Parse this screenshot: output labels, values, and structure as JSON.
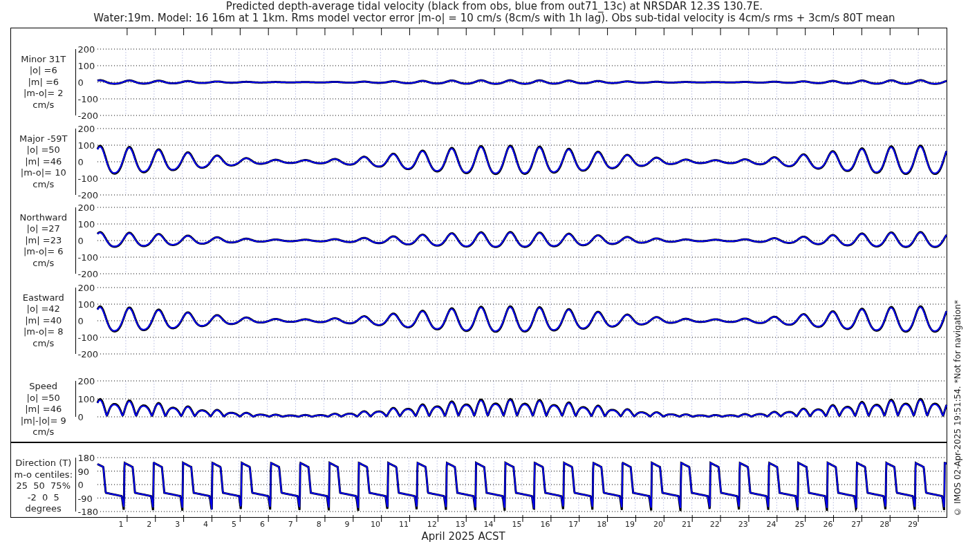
{
  "title_lines": [
    "Predicted depth-average tidal velocity (black from obs, blue from out71_13c) at NRSDAR 12.3S 130.7E.",
    "Water:19m. Model: 16 16m at 1 1km. Rms model vector error |m-o| = 10 cm/s (8cm/s with 1h lag). Obs sub-tidal velocity is 4cm/s rms + 3cm/s 80T mean"
  ],
  "panels": [
    {
      "kind": "signed",
      "label_lines": [
        "Minor 31T",
        "|o| =6",
        "|m| =6",
        "|m-o|= 2",
        "cm/s"
      ],
      "yticks": [
        "200",
        "100",
        "0",
        "-100",
        "-200"
      ]
    },
    {
      "kind": "signed",
      "label_lines": [
        "Major -59T",
        "|o| =50",
        "|m| =46",
        "|m-o|= 10",
        "cm/s"
      ],
      "yticks": [
        "200",
        "100",
        "0",
        "-100",
        "-200"
      ]
    },
    {
      "kind": "signed",
      "label_lines": [
        "Northward",
        "|o| =27",
        "|m| =23",
        "|m-o|= 6",
        "cm/s"
      ],
      "yticks": [
        "200",
        "100",
        "0",
        "-100",
        "-200"
      ]
    },
    {
      "kind": "signed",
      "label_lines": [
        "Eastward",
        "|o| =42",
        "|m| =40",
        "|m-o|= 8",
        "cm/s"
      ],
      "yticks": [
        "200",
        "100",
        "0",
        "-100",
        "-200"
      ]
    },
    {
      "kind": "speed",
      "label_lines": [
        "Speed",
        "|o| =50",
        "|m| =46",
        "|m|-|o|= 9",
        "cm/s"
      ],
      "yticks": [
        "200",
        "100",
        "0"
      ]
    }
  ],
  "direction_panel": {
    "kind": "direction",
    "label_lines": [
      "Direction (T)",
      "m-o centiles:",
      "25  50  75%",
      "-2  0  5",
      "degrees"
    ],
    "yticks": [
      "180",
      "90",
      "0",
      "-90",
      "-180"
    ]
  },
  "xticks": [
    "1",
    "2",
    "3",
    "4",
    "5",
    "6",
    "7",
    "8",
    "9",
    "10",
    "11",
    "12",
    "13",
    "14",
    "15",
    "16",
    "17",
    "18",
    "19",
    "20",
    "21",
    "22",
    "23",
    "24",
    "25",
    "26",
    "27",
    "28",
    "29"
  ],
  "xlabel": "April 2025 ACST",
  "copyright": "© IMOS 02-Apr-2025 19:51:54. *Not for navigation*"
}
